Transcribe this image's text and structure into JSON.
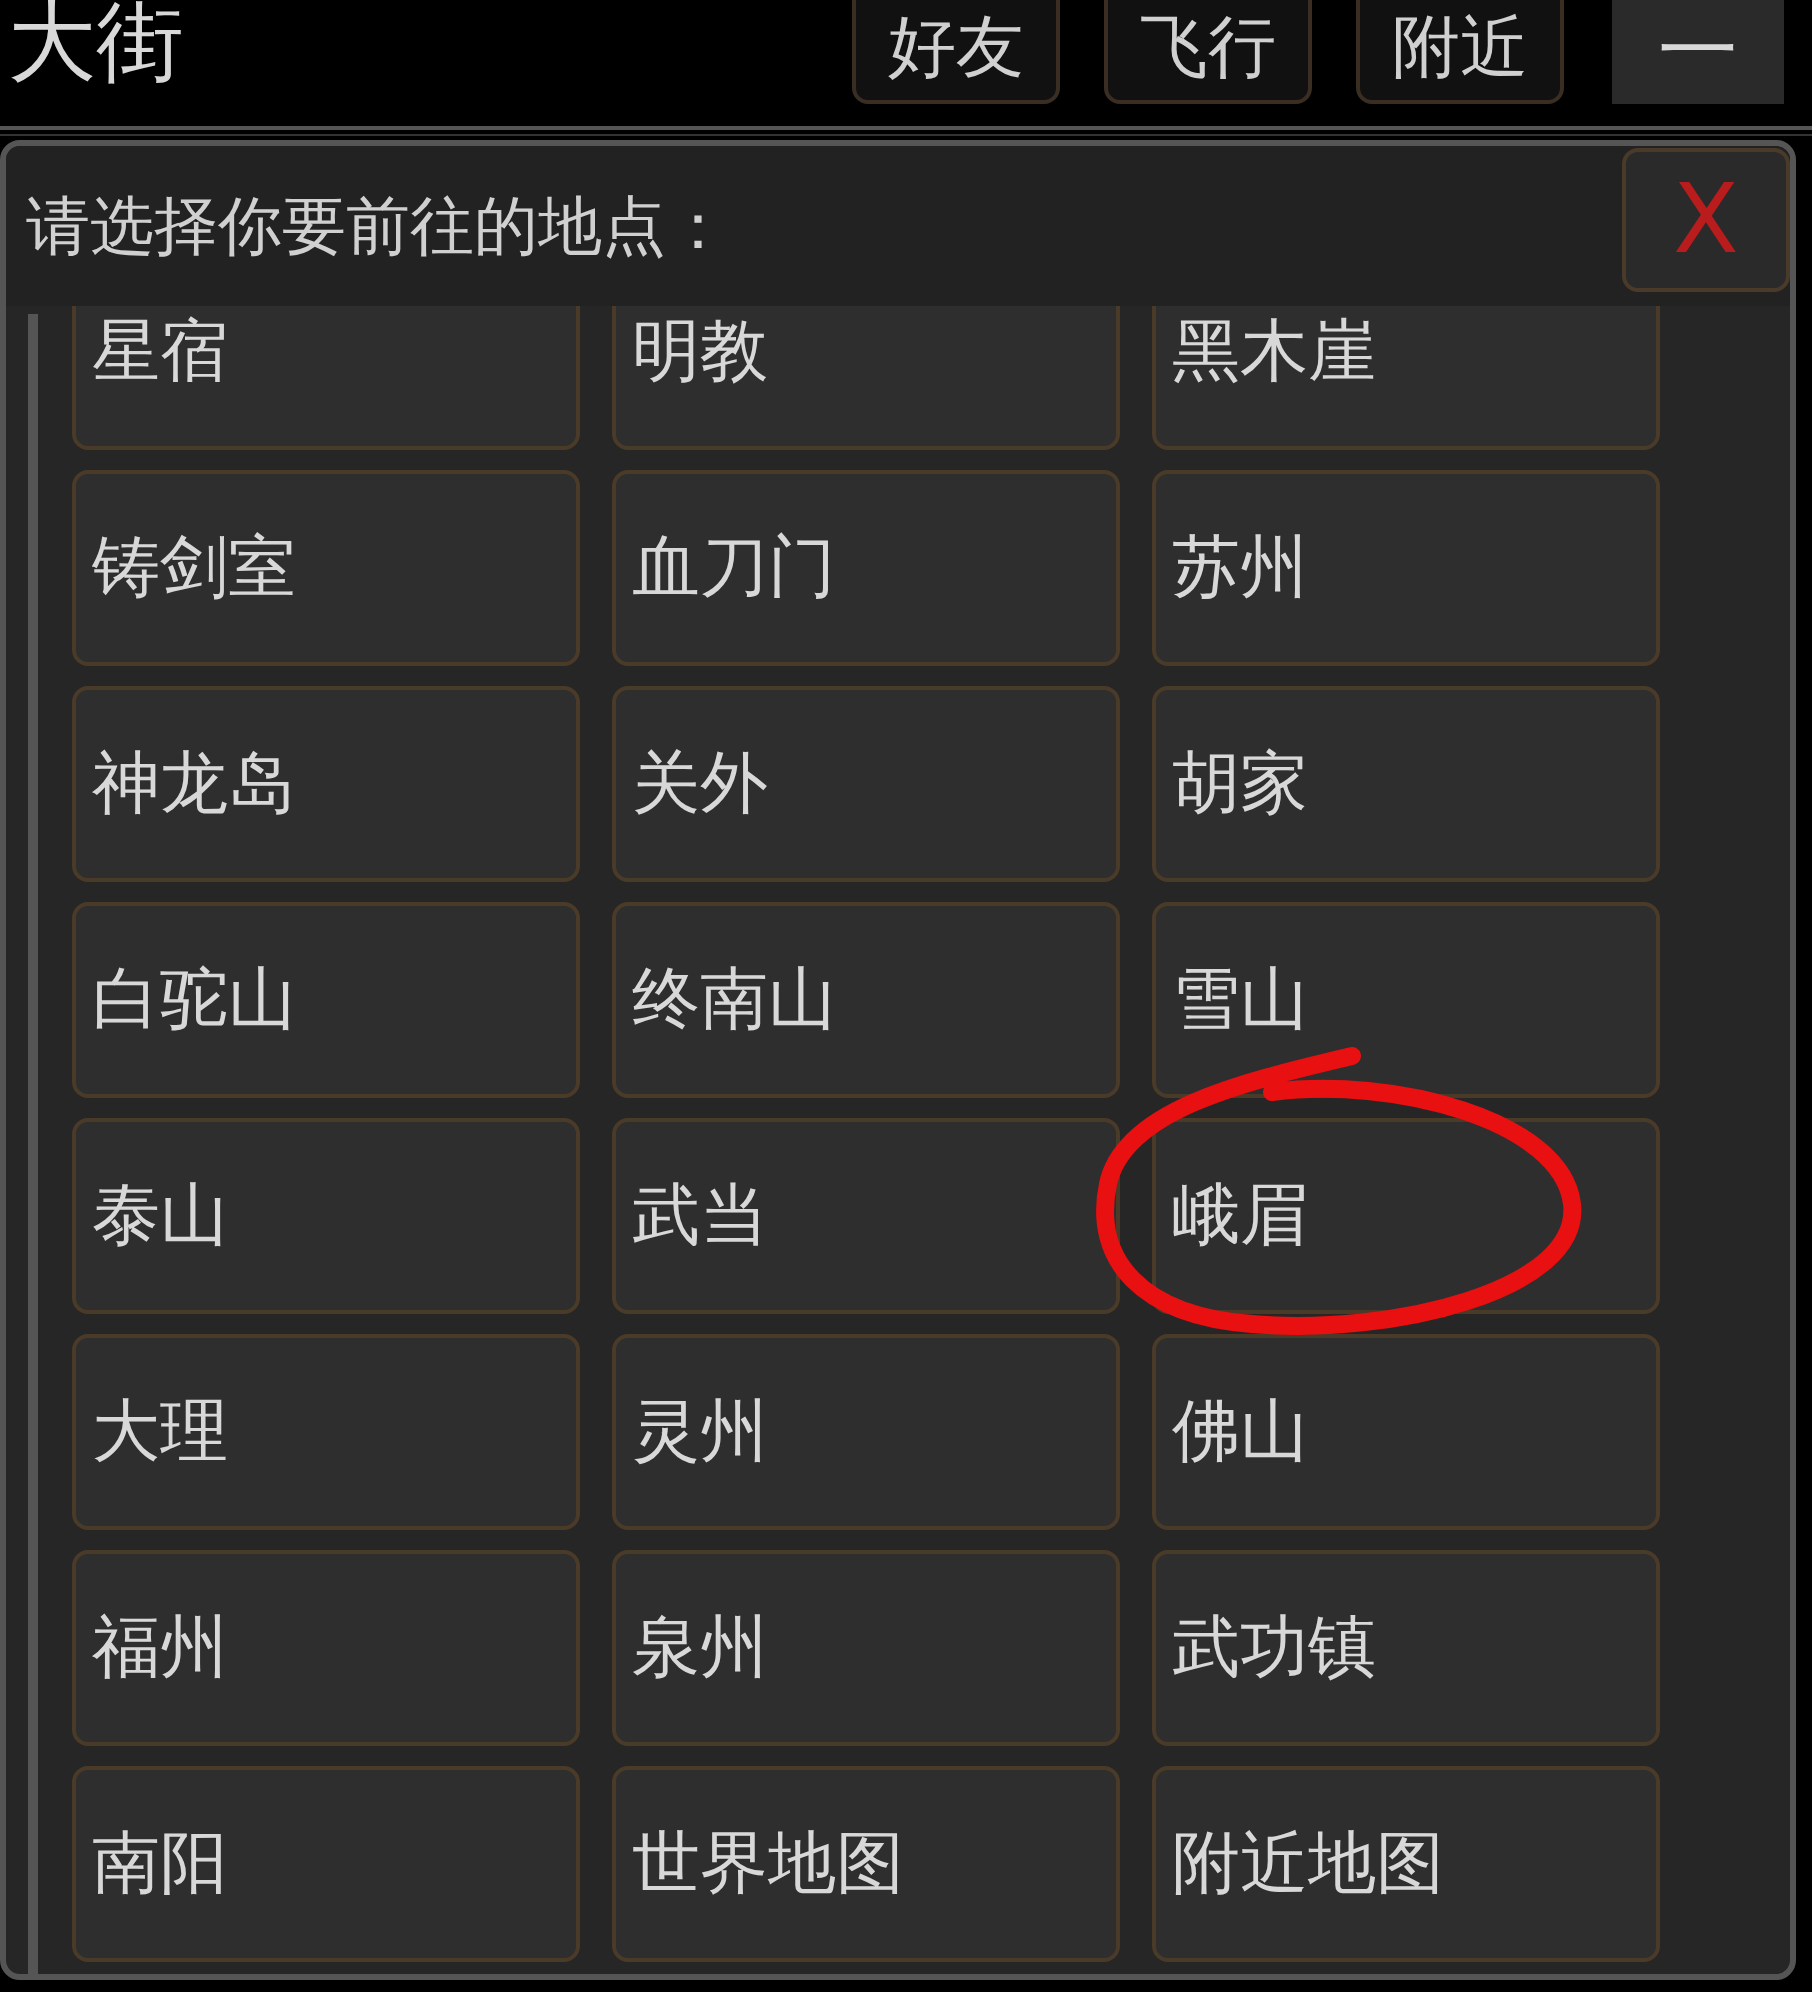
{
  "top_bar": {
    "title": "大街",
    "buttons": [
      "好友",
      "飞行",
      "附近"
    ],
    "minimize": "一"
  },
  "dialog": {
    "prompt": "请选择你要前往的地点：",
    "close": "X",
    "locations": [
      {
        "label": "星宿",
        "circled": false
      },
      {
        "label": "明教",
        "circled": false
      },
      {
        "label": "黑木崖",
        "circled": false
      },
      {
        "label": "铸剑室",
        "circled": false
      },
      {
        "label": "血刀门",
        "circled": false
      },
      {
        "label": "苏州",
        "circled": false
      },
      {
        "label": "神龙岛",
        "circled": false
      },
      {
        "label": "关外",
        "circled": false
      },
      {
        "label": "胡家",
        "circled": false
      },
      {
        "label": "白驼山",
        "circled": false
      },
      {
        "label": "终南山",
        "circled": false
      },
      {
        "label": "雪山",
        "circled": false
      },
      {
        "label": "泰山",
        "circled": false
      },
      {
        "label": "武当",
        "circled": false
      },
      {
        "label": "峨眉",
        "circled": true
      },
      {
        "label": "大理",
        "circled": false
      },
      {
        "label": "灵州",
        "circled": false
      },
      {
        "label": "佛山",
        "circled": false
      },
      {
        "label": "福州",
        "circled": false
      },
      {
        "label": "泉州",
        "circled": false
      },
      {
        "label": "武功镇",
        "circled": false
      },
      {
        "label": "南阳",
        "circled": false
      },
      {
        "label": "世界地图",
        "circled": false
      },
      {
        "label": "附近地图",
        "circled": false
      }
    ]
  }
}
